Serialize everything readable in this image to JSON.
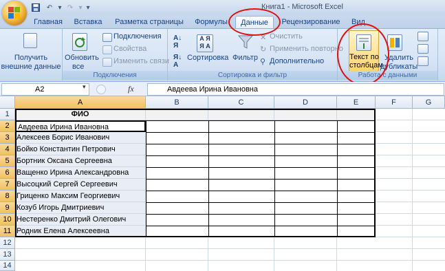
{
  "window": {
    "title": "Книга1 - Microsoft Excel"
  },
  "tabs": [
    {
      "label": "Главная"
    },
    {
      "label": "Вставка"
    },
    {
      "label": "Разметка страницы"
    },
    {
      "label": "Формулы"
    },
    {
      "label": "Данные"
    },
    {
      "label": "Рецензирование"
    },
    {
      "label": "Вид"
    }
  ],
  "ribbon": {
    "external": {
      "label_line1": "Получить",
      "label_line2": "внешние данные"
    },
    "connections": {
      "refresh_line1": "Обновить",
      "refresh_line2": "все",
      "connections": "Подключения",
      "properties": "Свойства",
      "edit_links": "Изменить связи",
      "group_label": "Подключения"
    },
    "sort_filter": {
      "sort": "Сортировка",
      "filter": "Фильтр",
      "clear": "Очистить",
      "reapply": "Применить повторно",
      "advanced": "Дополнительно",
      "group_label": "Сортировка и фильтр"
    },
    "data_tools": {
      "text_to_columns_line1": "Текст по",
      "text_to_columns_line2": "столбцам",
      "remove_dup_line1": "Удалить",
      "remove_dup_line2": "дубликаты",
      "group_label": "Работа с данными"
    }
  },
  "formula_bar": {
    "name_box": "A2",
    "fx": "fx",
    "value": "Авдеева Ирина Ивановна"
  },
  "sheet": {
    "columns": [
      "A",
      "B",
      "C",
      "D",
      "E",
      "F",
      "G"
    ],
    "rows": [
      "1",
      "2",
      "3",
      "4",
      "5",
      "6",
      "7",
      "8",
      "9",
      "10",
      "11",
      "12",
      "13",
      "14"
    ],
    "header_cell": "ФИО",
    "names": [
      "Авдеева Ирина Ивановна",
      "Алексеев Борис Иванович",
      "Бойко Константин Петрович",
      "Бортник Оксана Сергеевна",
      "Ващенко Ирина Александровна",
      "Высоцкий Сергей Сергеевич",
      "Гриценко Максим Георгиевич",
      "Козуб Игорь Дмитриевич",
      "Нестеренко Дмитрий Олегович",
      "Родник Елена Алексеевна"
    ],
    "selected_cell": "A2"
  },
  "colors": {
    "highlight": "#e01010",
    "selection": "#f1c15f"
  }
}
